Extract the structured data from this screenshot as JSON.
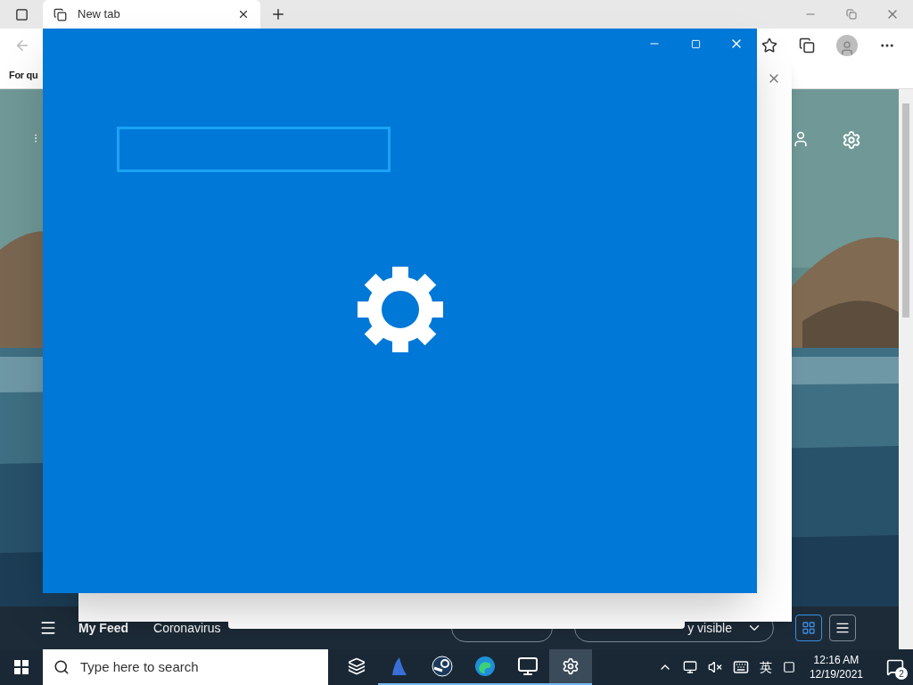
{
  "browser": {
    "tabs": [
      {
        "title": "New tab",
        "selected": true
      }
    ],
    "favorites_bar": {
      "text": "For qu"
    },
    "page": {
      "news_bar": {
        "feed_links": [
          {
            "label": "My Feed",
            "selected": true
          },
          {
            "label": "Coronavirus",
            "selected": false
          }
        ],
        "dropdown": {
          "text": "y visible"
        },
        "view_buttons": [
          {
            "kind": "grid",
            "selected": true
          },
          {
            "kind": "list",
            "selected": false
          }
        ]
      }
    }
  },
  "settings_window": {
    "loading": true
  },
  "taskbar": {
    "search": {
      "placeholder": "Type here to search"
    },
    "apps": [
      {
        "kind": "taskview",
        "selected": false,
        "running": false
      },
      {
        "kind": "bird",
        "selected": false,
        "running": true
      },
      {
        "kind": "steam",
        "selected": false,
        "running": true
      },
      {
        "kind": "edge",
        "selected": false,
        "running": true
      },
      {
        "kind": "remote",
        "selected": false,
        "running": true
      },
      {
        "kind": "settings",
        "selected": true,
        "running": true
      }
    ],
    "tray": {
      "language": "英",
      "time": "12:16 AM",
      "date": "12/19/2021",
      "notification_count": "2"
    }
  }
}
